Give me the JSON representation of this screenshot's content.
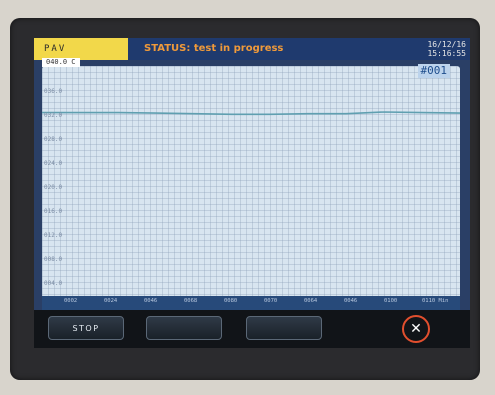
{
  "header": {
    "mode": "PAV",
    "status": "STATUS: test in progress",
    "date": "16/12/16",
    "time": "15:16:55"
  },
  "plot": {
    "y_max_label": "040.0 C",
    "y_tick_labels": [
      "036.0",
      "032.0",
      "028.0",
      "024.0",
      "020.0",
      "016.0",
      "012.0",
      "008.0",
      "004.0"
    ],
    "trace_id": "#001",
    "x_tick_labels": [
      "0002",
      "0024",
      "0046",
      "0068",
      "0080",
      "0070",
      "0064",
      "0046",
      "0100",
      "0110 Min"
    ]
  },
  "chart_data": {
    "type": "line",
    "title": "",
    "xlabel": "",
    "ylabel": "",
    "x": [
      0,
      10,
      20,
      30,
      40,
      50,
      60,
      70,
      80,
      90,
      100,
      110
    ],
    "series": [
      {
        "name": "#001",
        "values": [
          31.9,
          31.9,
          31.9,
          31.8,
          31.7,
          31.6,
          31.6,
          31.7,
          31.7,
          32.0,
          31.9,
          31.8
        ]
      }
    ],
    "ylim": [
      0,
      40
    ],
    "xlim": [
      0,
      110
    ],
    "grid": true,
    "line_color": "#5f9fb0"
  },
  "buttons": {
    "stop_label": "STOP",
    "btn2_label": "",
    "btn3_label": "",
    "close_glyph": "✕"
  },
  "colors": {
    "mode_bg": "#f2d84a",
    "status_text": "#f09a3a",
    "plot_bg": "#d8e5f0",
    "close_ring": "#e24f2e"
  }
}
